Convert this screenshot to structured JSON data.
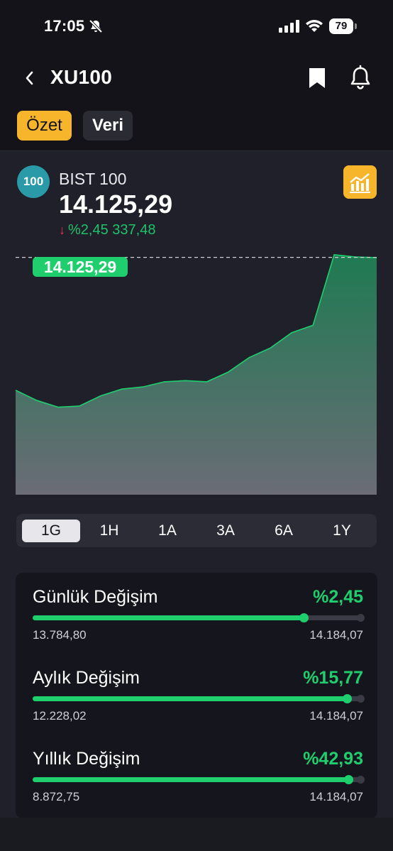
{
  "status_bar": {
    "time": "17:05",
    "battery": "79"
  },
  "header": {
    "title": "XU100"
  },
  "tabs": [
    {
      "label": "Özet",
      "active": true
    },
    {
      "label": "Veri",
      "active": false
    }
  ],
  "index": {
    "badge": "100",
    "name": "BIST 100",
    "price": "14.125,29",
    "change_percent": "%2,45",
    "change_value": "337,48",
    "change_direction": "down"
  },
  "price_tag": "14.125,29",
  "chart_data": {
    "type": "area",
    "y": [
      13890,
      13872,
      13860,
      13862,
      13880,
      13892,
      13896,
      13905,
      13907,
      13905,
      13922,
      13948,
      13965,
      13992,
      14005,
      14130,
      14126,
      14125
    ],
    "current": 14125.29,
    "ylim": [
      13705,
      14150
    ],
    "fill_top_color": "#1f7a52",
    "fill_bottom_color": "#6a6c76",
    "line_color": "#1fcf6e"
  },
  "periods": [
    {
      "label": "1G",
      "active": true
    },
    {
      "label": "1H",
      "active": false
    },
    {
      "label": "1A",
      "active": false
    },
    {
      "label": "3A",
      "active": false
    },
    {
      "label": "6A",
      "active": false
    },
    {
      "label": "1Y",
      "active": false
    }
  ],
  "stats": [
    {
      "label": "Günlük Değişim",
      "value": "%2,45",
      "min": "13.784,80",
      "max": "14.184,07",
      "progress": 0.82
    },
    {
      "label": "Aylık Değişim",
      "value": "%15,77",
      "min": "12.228,02",
      "max": "14.184,07",
      "progress": 0.95
    },
    {
      "label": "Yıllık Değişim",
      "value": "%42,93",
      "min": "8.872,75",
      "max": "14.184,07",
      "progress": 0.955
    }
  ],
  "colors": {
    "accent": "#f7b52c",
    "positive": "#1fcf6e",
    "negative": "#e5384a",
    "badge": "#2b9aa8"
  }
}
